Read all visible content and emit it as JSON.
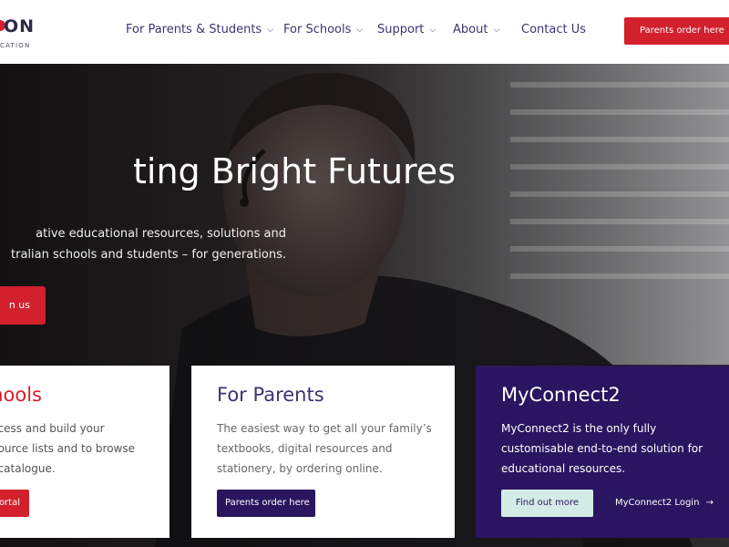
{
  "logo": {
    "wordmark": "ON",
    "subtitle": "CATION"
  },
  "nav": {
    "items": [
      {
        "label": "For Parents & Students",
        "has_dropdown": true
      },
      {
        "label": "For Schools",
        "has_dropdown": true
      },
      {
        "label": "Support",
        "has_dropdown": true
      },
      {
        "label": "About",
        "has_dropdown": true
      },
      {
        "label": "Contact Us",
        "has_dropdown": false
      }
    ],
    "order_button": "Parents order here"
  },
  "hero": {
    "title": "ting Bright Futures",
    "text_line1": "ative educational resources, solutions and",
    "text_line2": "tralian schools and students – for generations.",
    "button": "n us"
  },
  "cards": {
    "schools": {
      "title": "hools",
      "line1": "cess and build your",
      "line2": "ource lists and to browse",
      "line3": "catalogue.",
      "button": "portal"
    },
    "parents": {
      "title": "For Parents",
      "line1": "The easiest way to get all your family’s",
      "line2": "textbooks, digital resources and",
      "line3": "stationery, by ordering online.",
      "button": "Parents order here"
    },
    "myconnect": {
      "title": "MyConnect2",
      "line1": "MyConnect2 is the only fully",
      "line2": "customisable end-to-end solution for",
      "line3": "educational resources.",
      "button_find": "Find out more",
      "button_login": "MyConnect2 Login"
    }
  },
  "colors": {
    "brand_red": "#d3202d",
    "brand_purple": "#2a1560",
    "nav_text": "#3a3470",
    "mint_button": "#d4ece6"
  },
  "icons": {
    "dropdown": "chevron-down-icon",
    "login_arrow": "arrow-right-icon"
  }
}
